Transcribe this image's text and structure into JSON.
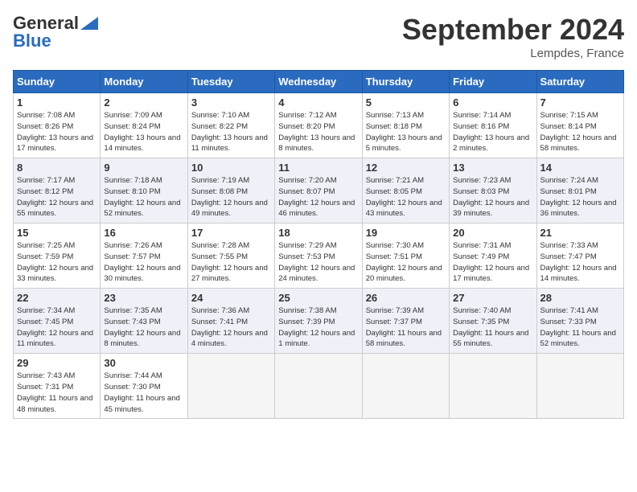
{
  "header": {
    "logo_line1": "General",
    "logo_line2": "Blue",
    "month": "September 2024",
    "location": "Lempdes, France"
  },
  "days_of_week": [
    "Sunday",
    "Monday",
    "Tuesday",
    "Wednesday",
    "Thursday",
    "Friday",
    "Saturday"
  ],
  "weeks": [
    [
      {
        "day": 1,
        "sunrise": "Sunrise: 7:08 AM",
        "sunset": "Sunset: 8:26 PM",
        "daylight": "Daylight: 13 hours and 17 minutes."
      },
      {
        "day": 2,
        "sunrise": "Sunrise: 7:09 AM",
        "sunset": "Sunset: 8:24 PM",
        "daylight": "Daylight: 13 hours and 14 minutes."
      },
      {
        "day": 3,
        "sunrise": "Sunrise: 7:10 AM",
        "sunset": "Sunset: 8:22 PM",
        "daylight": "Daylight: 13 hours and 11 minutes."
      },
      {
        "day": 4,
        "sunrise": "Sunrise: 7:12 AM",
        "sunset": "Sunset: 8:20 PM",
        "daylight": "Daylight: 13 hours and 8 minutes."
      },
      {
        "day": 5,
        "sunrise": "Sunrise: 7:13 AM",
        "sunset": "Sunset: 8:18 PM",
        "daylight": "Daylight: 13 hours and 5 minutes."
      },
      {
        "day": 6,
        "sunrise": "Sunrise: 7:14 AM",
        "sunset": "Sunset: 8:16 PM",
        "daylight": "Daylight: 13 hours and 2 minutes."
      },
      {
        "day": 7,
        "sunrise": "Sunrise: 7:15 AM",
        "sunset": "Sunset: 8:14 PM",
        "daylight": "Daylight: 12 hours and 58 minutes."
      }
    ],
    [
      {
        "day": 8,
        "sunrise": "Sunrise: 7:17 AM",
        "sunset": "Sunset: 8:12 PM",
        "daylight": "Daylight: 12 hours and 55 minutes."
      },
      {
        "day": 9,
        "sunrise": "Sunrise: 7:18 AM",
        "sunset": "Sunset: 8:10 PM",
        "daylight": "Daylight: 12 hours and 52 minutes."
      },
      {
        "day": 10,
        "sunrise": "Sunrise: 7:19 AM",
        "sunset": "Sunset: 8:08 PM",
        "daylight": "Daylight: 12 hours and 49 minutes."
      },
      {
        "day": 11,
        "sunrise": "Sunrise: 7:20 AM",
        "sunset": "Sunset: 8:07 PM",
        "daylight": "Daylight: 12 hours and 46 minutes."
      },
      {
        "day": 12,
        "sunrise": "Sunrise: 7:21 AM",
        "sunset": "Sunset: 8:05 PM",
        "daylight": "Daylight: 12 hours and 43 minutes."
      },
      {
        "day": 13,
        "sunrise": "Sunrise: 7:23 AM",
        "sunset": "Sunset: 8:03 PM",
        "daylight": "Daylight: 12 hours and 39 minutes."
      },
      {
        "day": 14,
        "sunrise": "Sunrise: 7:24 AM",
        "sunset": "Sunset: 8:01 PM",
        "daylight": "Daylight: 12 hours and 36 minutes."
      }
    ],
    [
      {
        "day": 15,
        "sunrise": "Sunrise: 7:25 AM",
        "sunset": "Sunset: 7:59 PM",
        "daylight": "Daylight: 12 hours and 33 minutes."
      },
      {
        "day": 16,
        "sunrise": "Sunrise: 7:26 AM",
        "sunset": "Sunset: 7:57 PM",
        "daylight": "Daylight: 12 hours and 30 minutes."
      },
      {
        "day": 17,
        "sunrise": "Sunrise: 7:28 AM",
        "sunset": "Sunset: 7:55 PM",
        "daylight": "Daylight: 12 hours and 27 minutes."
      },
      {
        "day": 18,
        "sunrise": "Sunrise: 7:29 AM",
        "sunset": "Sunset: 7:53 PM",
        "daylight": "Daylight: 12 hours and 24 minutes."
      },
      {
        "day": 19,
        "sunrise": "Sunrise: 7:30 AM",
        "sunset": "Sunset: 7:51 PM",
        "daylight": "Daylight: 12 hours and 20 minutes."
      },
      {
        "day": 20,
        "sunrise": "Sunrise: 7:31 AM",
        "sunset": "Sunset: 7:49 PM",
        "daylight": "Daylight: 12 hours and 17 minutes."
      },
      {
        "day": 21,
        "sunrise": "Sunrise: 7:33 AM",
        "sunset": "Sunset: 7:47 PM",
        "daylight": "Daylight: 12 hours and 14 minutes."
      }
    ],
    [
      {
        "day": 22,
        "sunrise": "Sunrise: 7:34 AM",
        "sunset": "Sunset: 7:45 PM",
        "daylight": "Daylight: 12 hours and 11 minutes."
      },
      {
        "day": 23,
        "sunrise": "Sunrise: 7:35 AM",
        "sunset": "Sunset: 7:43 PM",
        "daylight": "Daylight: 12 hours and 8 minutes."
      },
      {
        "day": 24,
        "sunrise": "Sunrise: 7:36 AM",
        "sunset": "Sunset: 7:41 PM",
        "daylight": "Daylight: 12 hours and 4 minutes."
      },
      {
        "day": 25,
        "sunrise": "Sunrise: 7:38 AM",
        "sunset": "Sunset: 7:39 PM",
        "daylight": "Daylight: 12 hours and 1 minute."
      },
      {
        "day": 26,
        "sunrise": "Sunrise: 7:39 AM",
        "sunset": "Sunset: 7:37 PM",
        "daylight": "Daylight: 11 hours and 58 minutes."
      },
      {
        "day": 27,
        "sunrise": "Sunrise: 7:40 AM",
        "sunset": "Sunset: 7:35 PM",
        "daylight": "Daylight: 11 hours and 55 minutes."
      },
      {
        "day": 28,
        "sunrise": "Sunrise: 7:41 AM",
        "sunset": "Sunset: 7:33 PM",
        "daylight": "Daylight: 11 hours and 52 minutes."
      }
    ],
    [
      {
        "day": 29,
        "sunrise": "Sunrise: 7:43 AM",
        "sunset": "Sunset: 7:31 PM",
        "daylight": "Daylight: 11 hours and 48 minutes."
      },
      {
        "day": 30,
        "sunrise": "Sunrise: 7:44 AM",
        "sunset": "Sunset: 7:30 PM",
        "daylight": "Daylight: 11 hours and 45 minutes."
      },
      null,
      null,
      null,
      null,
      null
    ]
  ]
}
